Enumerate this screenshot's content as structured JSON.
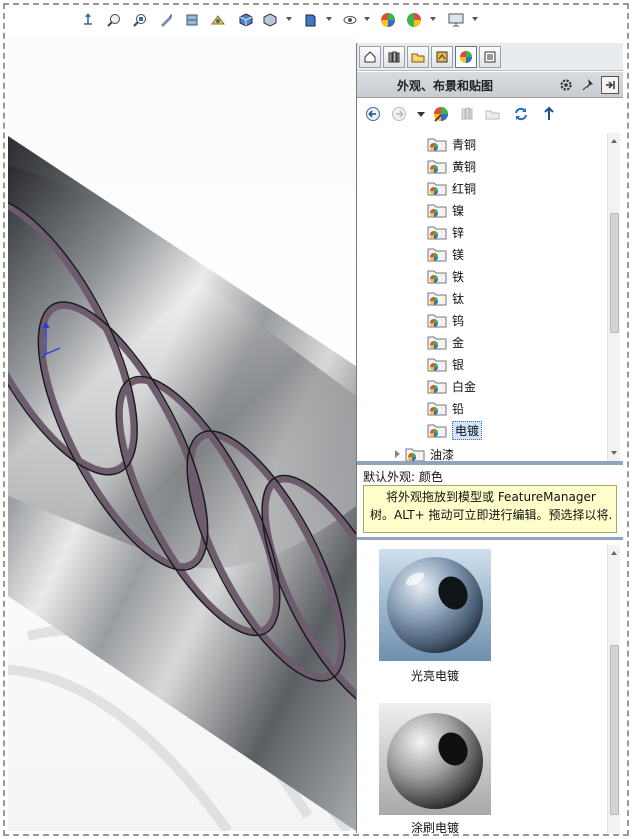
{
  "toolbar": {
    "icons": [
      "view-orientation-icon",
      "zoom-to-fit-icon",
      "zoom-to-area-icon",
      "previous-view-icon",
      "section-view-icon",
      "dynamic-annotation-icon",
      "view-orientation-cube-icon",
      "display-style-icon",
      "hide-show-items-icon",
      "edit-appearance-icon",
      "apply-scene-icon",
      "view-settings-icon",
      "display-icon"
    ]
  },
  "pane": {
    "tabs": [
      "home-tab-icon",
      "design-library-tab-icon",
      "file-explorer-tab-icon",
      "view-palette-tab-icon",
      "appearances-tab-icon",
      "custom-properties-tab-icon"
    ],
    "title": "外观、布景和贴图",
    "nav_icons": [
      "back-icon",
      "forward-icon",
      "history-dropdown-icon",
      "appearances-icon",
      "add-folder-icon",
      "open-folder-icon",
      "refresh-icon",
      "up-icon"
    ]
  },
  "tree": {
    "items": [
      {
        "label": "青铜"
      },
      {
        "label": "黄铜"
      },
      {
        "label": "红铜"
      },
      {
        "label": "镍"
      },
      {
        "label": "锌"
      },
      {
        "label": "镁"
      },
      {
        "label": "铁"
      },
      {
        "label": "钛"
      },
      {
        "label": "钨"
      },
      {
        "label": "金"
      },
      {
        "label": "银"
      },
      {
        "label": "白金"
      },
      {
        "label": "铅"
      },
      {
        "label": "电镀"
      }
    ],
    "selected": "电镀",
    "next_top": "油漆"
  },
  "info": {
    "default_label": "默认外观: 颜色",
    "tip_line1": "将外观拖放到模型或 FeatureManager",
    "tip_line2": "树。ALT+ 拖动可立即进行编辑。预选择以将..."
  },
  "gallery": {
    "items": [
      {
        "caption": "光亮电镀"
      },
      {
        "caption": "涂刷电镀"
      }
    ]
  },
  "colors": {
    "pane_title_bg": "#c9cdd1",
    "tip_bg": "#ffffcc",
    "selection": "#cfe3fb",
    "split_bar": "#8fa4bd"
  }
}
